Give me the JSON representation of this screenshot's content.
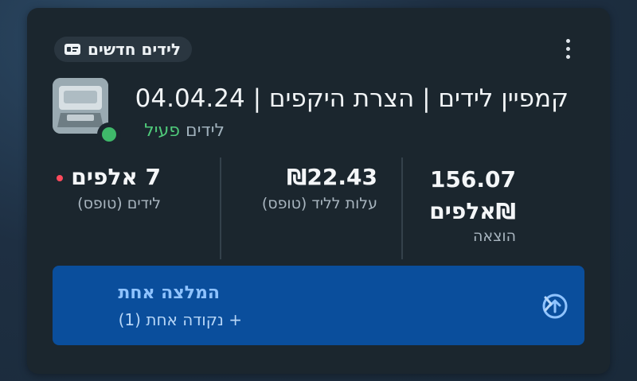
{
  "card": {
    "badge_label": "לידים חדשים",
    "title": "קמפיין לידים | הצרת היקפים | 04.04.24",
    "subtitle_label": "לידים",
    "status": "פעיל"
  },
  "metrics": [
    {
      "value": "7 אלפים",
      "label": "לידים (טופס)"
    },
    {
      "value": "₪22.43",
      "label": "עלות לליד (טופס)"
    },
    {
      "value_line1": "156.07",
      "value_line2": "₪אלפים",
      "label": "הוצאה"
    }
  ],
  "recommendation": {
    "title": "המלצה אחת",
    "subtitle": "+ נקודה אחת (1)"
  },
  "colors": {
    "card_bg": "#1b262e",
    "active_green": "#4fc97a",
    "alert_red": "#ff4a5c",
    "reco_bg": "#0a4e9c",
    "reco_title": "#8fc3ff"
  }
}
